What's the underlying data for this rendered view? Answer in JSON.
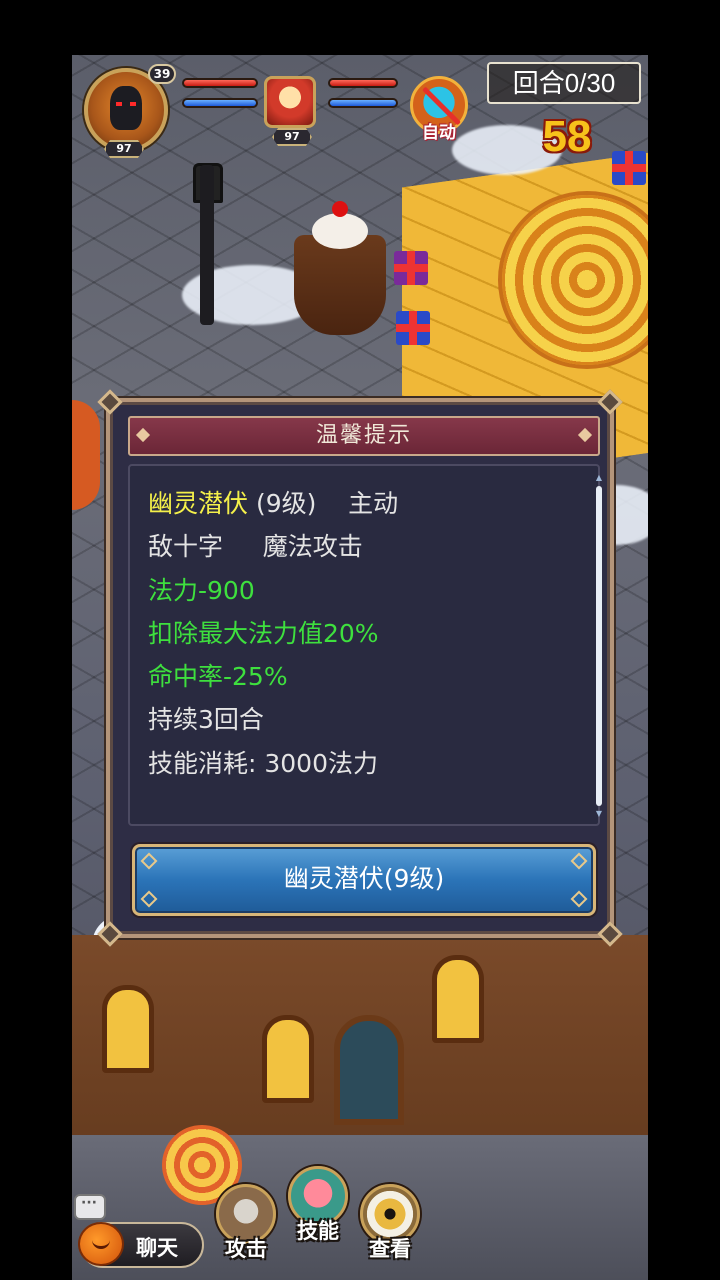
{
  "hud": {
    "player_level": "39",
    "player_badge": "97",
    "pet_badge": "97",
    "auto_label": "自动",
    "round": "回合0/30",
    "timer": "58"
  },
  "dialog": {
    "title": "温馨提示",
    "skill_name": "幽灵潜伏",
    "skill_level": " (9级)",
    "skill_type": "    主动",
    "target": "敌十字",
    "attack_type": "     魔法攻击",
    "effects": [
      "法力-900",
      "扣除最大法力值20%",
      "命中率-25%"
    ],
    "duration": "持续3回合",
    "cost": "技能消耗: 3000法力",
    "button_label": "幽灵潜伏(9级)"
  },
  "actions": {
    "chat": "聊天",
    "attack": "攻击",
    "skill": "技能",
    "view": "查看"
  },
  "colors": {
    "dialog_bg": "#2e2d45",
    "header_bg": "#86384a",
    "highlight_yellow": "#f4f04a",
    "effect_green": "#3ee03e",
    "button_blue": "#2b74b8",
    "timer_yellow": "#f7c21b"
  },
  "icons": [
    "jackal-avatar-icon",
    "girl-pet-avatar-icon",
    "auto-battle-icon",
    "chat-bubble-icon",
    "pumpkin-icon",
    "attack-icon",
    "skill-icon",
    "view-eye-icon"
  ]
}
